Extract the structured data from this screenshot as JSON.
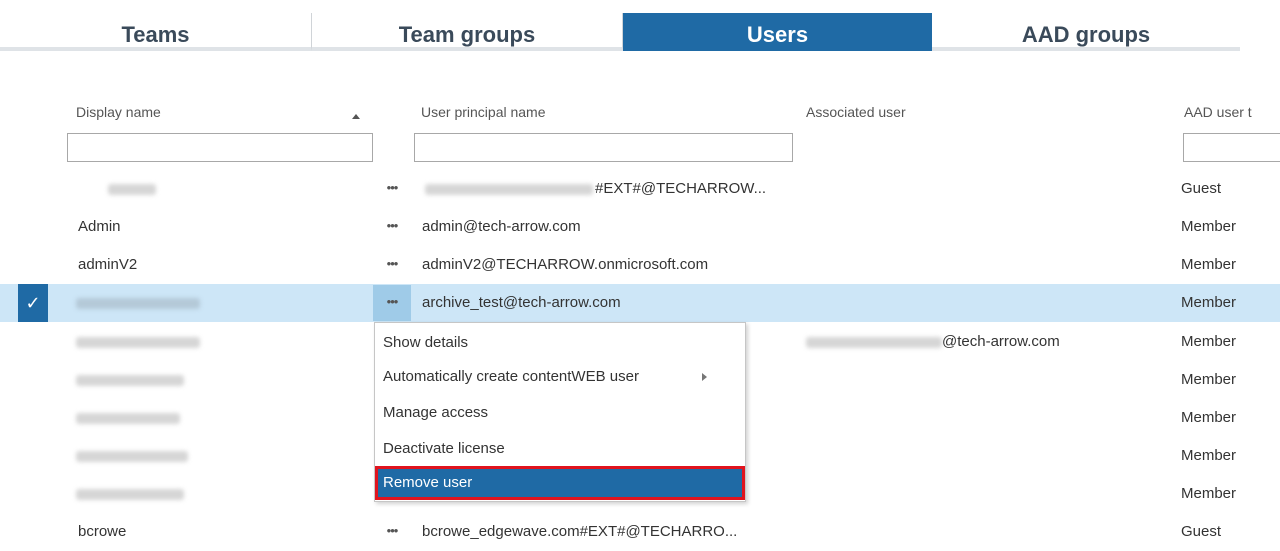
{
  "tabs": [
    {
      "label": "Teams",
      "active": false
    },
    {
      "label": "Team groups",
      "active": false
    },
    {
      "label": "Users",
      "active": true
    },
    {
      "label": "AAD groups",
      "active": false
    }
  ],
  "columns": {
    "display_name": "Display name",
    "upn": "User principal name",
    "associated": "Associated user",
    "aad_type": "AAD user t"
  },
  "filters": {
    "display_name": "",
    "upn": "",
    "aad_type": ""
  },
  "more_label": "•••",
  "check_glyph": "✓",
  "rows": [
    {
      "display_name": "",
      "upn": "#EXT#@TECHARROW...",
      "associated": "",
      "type": "Guest"
    },
    {
      "display_name": "Admin",
      "upn": "admin@tech-arrow.com",
      "associated": "",
      "type": "Member"
    },
    {
      "display_name": "adminV2",
      "upn": "adminV2@TECHARROW.onmicrosoft.com",
      "associated": "",
      "type": "Member"
    },
    {
      "display_name": "",
      "upn": "archive_test@tech-arrow.com",
      "associated": "",
      "type": "Member",
      "selected": true
    },
    {
      "display_name": "",
      "upn": "",
      "associated": "@tech-arrow.com",
      "type": "Member"
    },
    {
      "display_name": "",
      "upn": "",
      "associated": "",
      "type": "Member"
    },
    {
      "display_name": "",
      "upn": "",
      "associated": "",
      "type": "Member"
    },
    {
      "display_name": "",
      "upn": "",
      "associated": "",
      "type": "Member"
    },
    {
      "display_name": "",
      "upn": "",
      "associated": "",
      "type": "Member"
    },
    {
      "display_name": "bcrowe",
      "upn": "bcrowe_edgewave.com#EXT#@TECHARRO...",
      "associated": "",
      "type": "Guest"
    }
  ],
  "context_menu": {
    "items": [
      {
        "label": "Show details"
      },
      {
        "label": "Automatically create contentWEB user",
        "has_submenu": true
      },
      {
        "label": "Manage access"
      },
      {
        "label": "Deactivate license"
      },
      {
        "label": "Remove user",
        "highlighted": true
      }
    ]
  },
  "colors": {
    "accent": "#1f6aa5",
    "selected_row": "#cde6f7",
    "highlight_outline": "#e0141e"
  }
}
